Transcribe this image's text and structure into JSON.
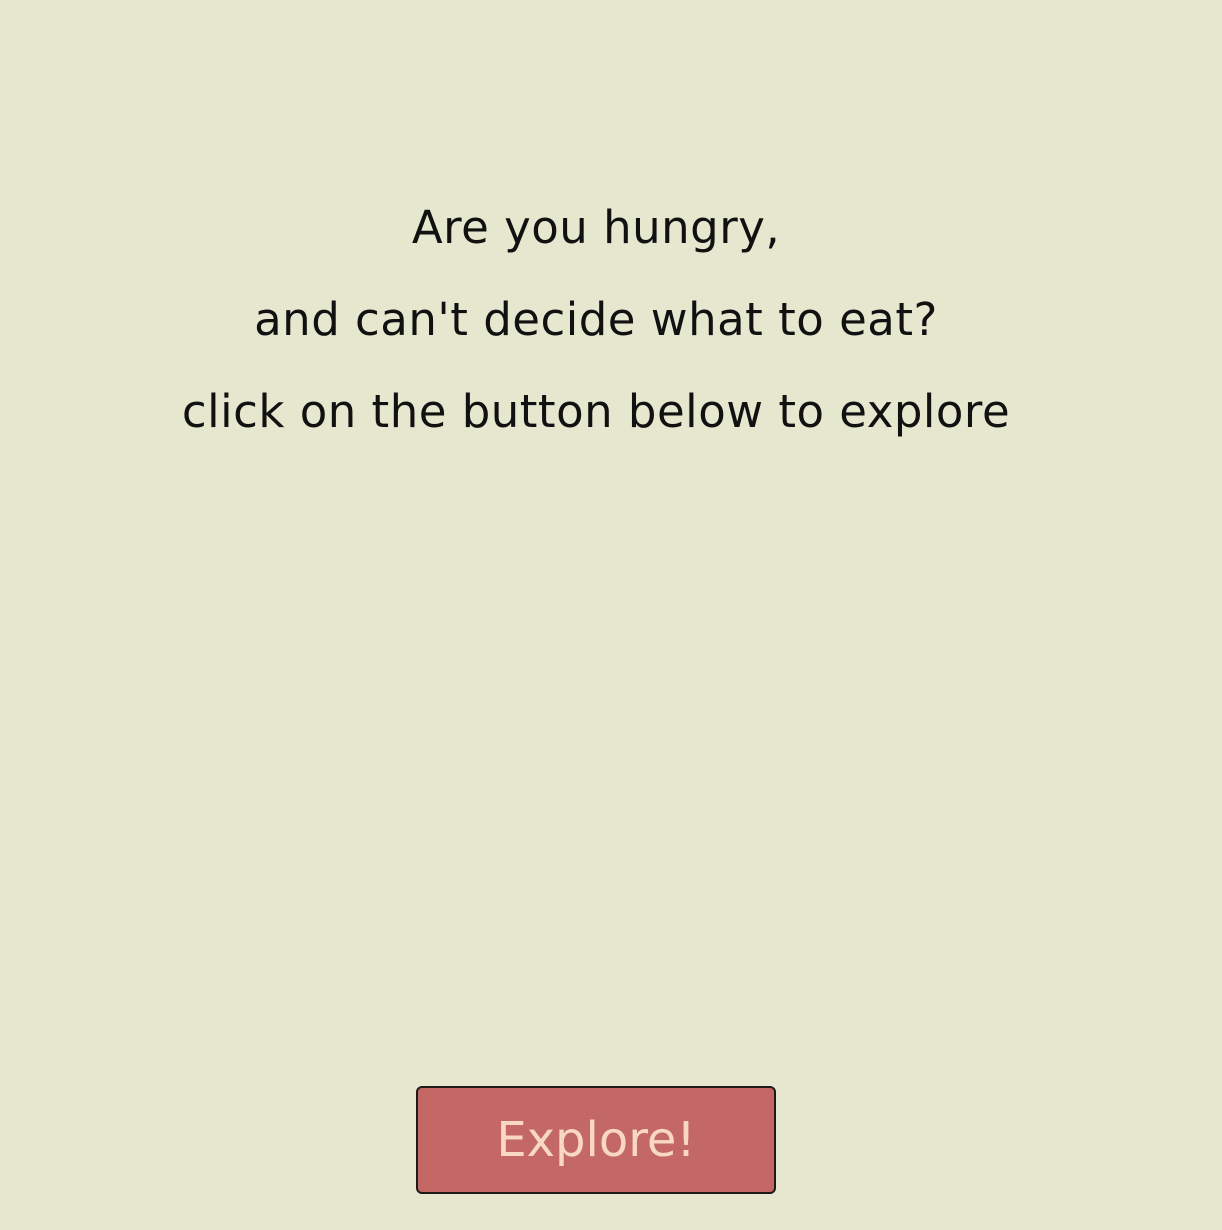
{
  "intro": {
    "line1": "Are you hungry,",
    "line2": "and can't decide what to eat?",
    "line3": "click on the button below to explore"
  },
  "button": {
    "label": "Explore!"
  },
  "colors": {
    "background": "#e6e7cf",
    "text": "#111111",
    "button_bg": "#c46865",
    "button_text": "#f8d7c5",
    "button_border": "#1f1a1a"
  }
}
